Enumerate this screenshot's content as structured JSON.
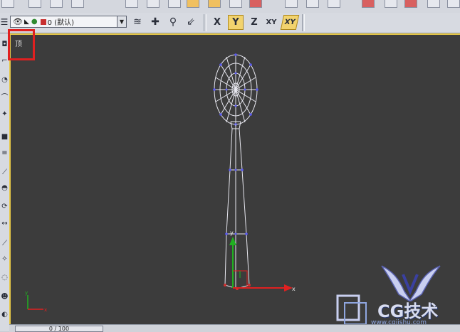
{
  "toolbar": {
    "layer_dropdown": {
      "value": "0 (默认)",
      "icon": "eye-icon"
    },
    "buttons": [
      "layer-manager-icon",
      "add-layer-icon",
      "select-in-layer-icon",
      "set-current-layer-icon"
    ],
    "axis_constraints": [
      {
        "label": "X",
        "active": false
      },
      {
        "label": "Y",
        "active": true
      },
      {
        "label": "Z",
        "active": false
      },
      {
        "label": "XY",
        "active": false
      },
      {
        "label": "XY",
        "active": true
      }
    ]
  },
  "viewport": {
    "label": "顶",
    "highlight_color": "#e02020",
    "active_border_color": "#e7c846",
    "background_color": "#3c3c3c"
  },
  "timeline": {
    "frame_text": "0 / 100"
  },
  "watermark": {
    "text": "CG技术",
    "url": "www.cgjishu.com",
    "color": "#c9cff0"
  }
}
